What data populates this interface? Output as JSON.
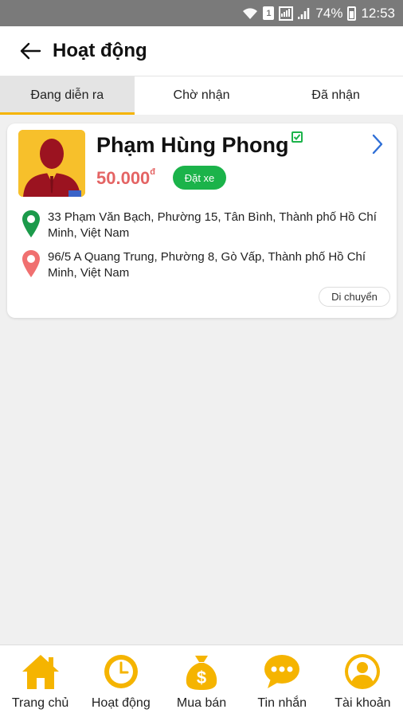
{
  "status_bar": {
    "sim_label": "1",
    "battery_percent": "74%",
    "time": "12:53"
  },
  "header": {
    "title": "Hoạt động"
  },
  "tabs": [
    {
      "label": "Đang diễn ra",
      "active": true
    },
    {
      "label": "Chờ nhận",
      "active": false
    },
    {
      "label": "Đã nhận",
      "active": false
    }
  ],
  "trip_card": {
    "name": "Phạm Hùng Phong",
    "price": "50.000",
    "currency": "đ",
    "status_badge": "Đặt xe",
    "pickup_address": "33 Phạm Văn Bạch, Phường 15, Tân Bình, Thành phố Hồ Chí Minh, Việt Nam",
    "dropoff_address": "96/5 A Quang Trung, Phường 8, Gò Vấp, Thành phố Hồ Chí Minh, Việt Nam",
    "move_button": "Di chuyển"
  },
  "bottom_nav": [
    {
      "label": "Trang chủ",
      "icon": "home-icon"
    },
    {
      "label": "Hoạt động",
      "icon": "clock-icon"
    },
    {
      "label": "Mua bán",
      "icon": "money-bag-icon"
    },
    {
      "label": "Tin nhắn",
      "icon": "chat-icon"
    },
    {
      "label": "Tài khoản",
      "icon": "account-icon"
    }
  ],
  "colors": {
    "accent": "#f5b400",
    "green": "#1bb34a",
    "price_red": "#e46464",
    "pin_red": "#f07070"
  }
}
